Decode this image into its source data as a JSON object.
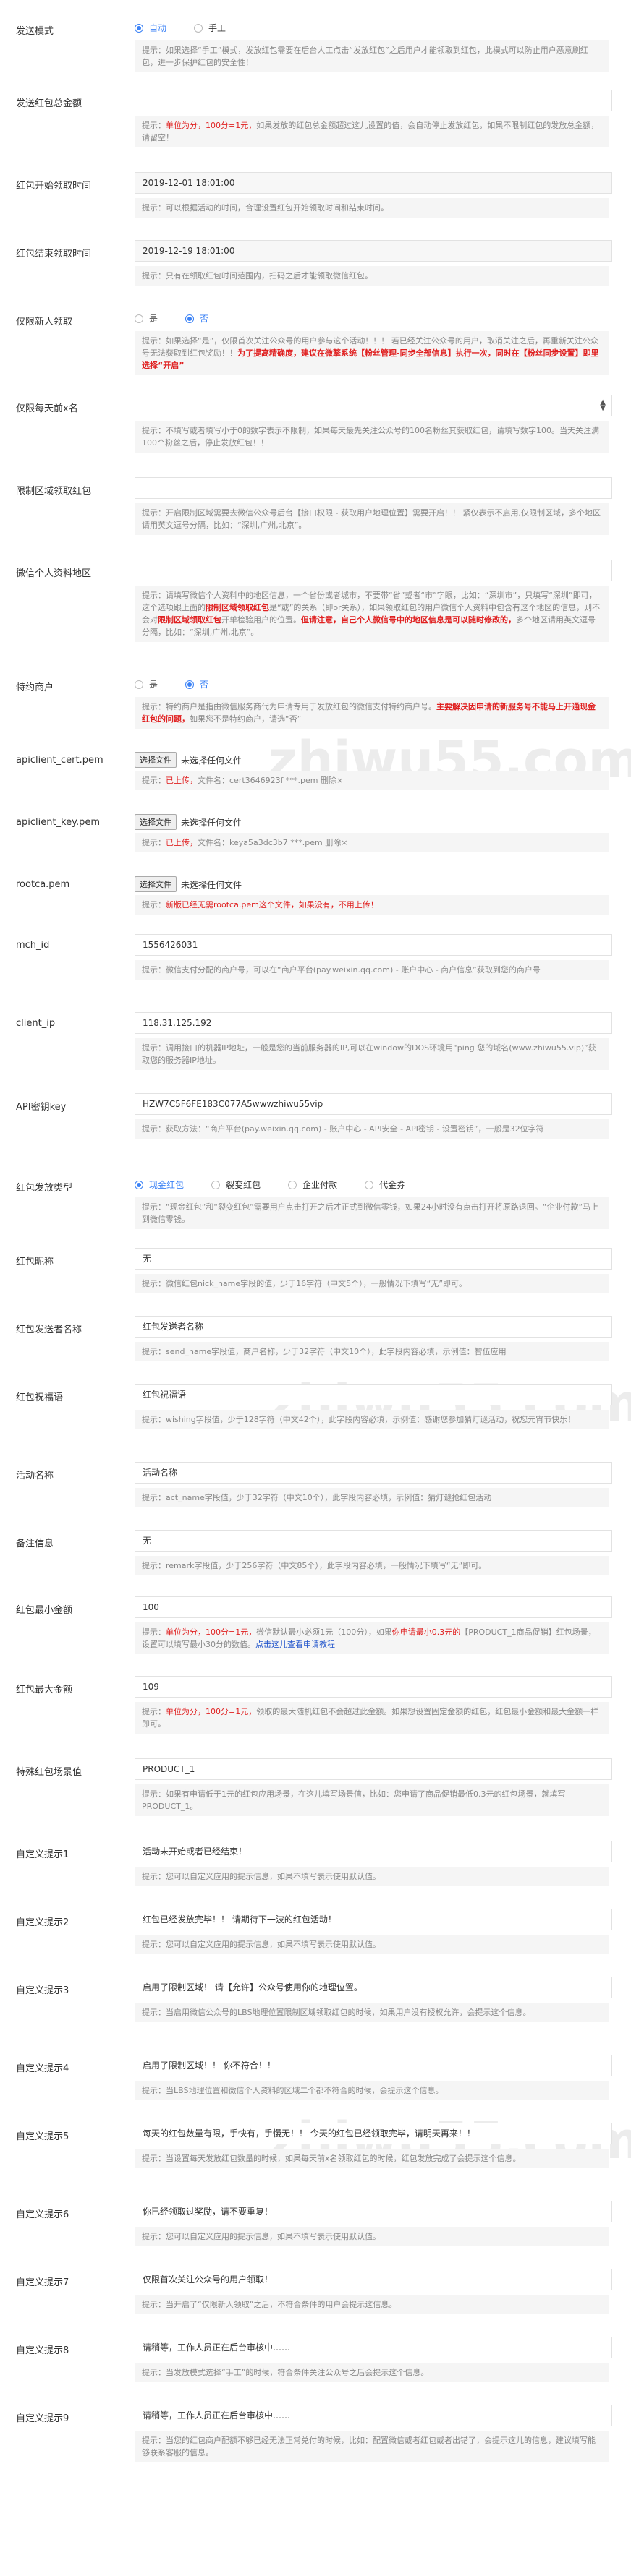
{
  "watermark": "zhiwu55.com",
  "fields": {
    "send_mode": {
      "label": "发送模式",
      "options": [
        {
          "label": "自动",
          "checked": true
        },
        {
          "label": "手工",
          "checked": false
        }
      ],
      "hint": "提示：如果选择“手工”模式，发放红包需要在后台人工点击“发放红包”之后用户才能领取到红包，此模式可以防止用户恶意刷红包，进一步保护红包的安全性！"
    },
    "total_amount": {
      "label": "发送红包总金额",
      "value": "",
      "hint_red": "单位为分，100分=1元，",
      "hint": "如果发放的红包总金额超过这儿设置的值，会自动停止发放红包，如果不限制红包的发放总金额，请留空！"
    },
    "start_time": {
      "label": "红包开始领取时间",
      "label_bold": "开始",
      "value": "2019-12-01 18:01:00",
      "hint": "提示：可以根据活动的时间，合理设置红包开始领取时间和结束时间。"
    },
    "end_time": {
      "label": "红包结束领取时间",
      "label_bold": "结束",
      "value": "2019-12-19 18:01:00",
      "hint": "提示：只有在领取红包时间范围内，扫码之后才能领取微信红包。"
    },
    "new_user": {
      "label": "仅限新人领取",
      "options": [
        {
          "label": "是",
          "checked": false
        },
        {
          "label": "否",
          "checked": true
        }
      ],
      "hint": "提示：如果选择“是”，仅限首次关注公众号的用户参与这个活动！！！ 若已经关注公众号的用户，取消关注之后，再重新关注公众号无法获取到红包奖励！！",
      "hint_red": "为了提高精确度，建议在微擎系统【粉丝管理-同步全部信息】执行一次，同时在【粉丝同步设置】即里选择“开启”"
    },
    "daily_limit": {
      "label": "仅限每天前x名",
      "value": "",
      "hint": "提示：不填写或者填写小于0的数字表示不限制，如果每天最先关注公众号的100名粉丝其获取红包，请填写数字100。当天关注满100个粉丝之后，停止发放红包！！"
    },
    "region_limit": {
      "label": "限制区域领取红包",
      "value": "",
      "hint": "提示：开启限制区域需要去微信公众号后台【接口权限 - 获取用户地理位置】需要开启！！ 紧仅表示不启用,仅限制区域，多个地区请用英文逗号分隔，比如：“深圳,广州,北京”。"
    },
    "personal_region": {
      "label": "微信个人资料地区",
      "value": "",
      "hint": "提示：请填写微信个人资料中的地区信息，一个省份或者城市，不要带“省”或者“市”字眼，比如：“深圳市”，只填写“深圳”即可，这个选项跟上面的",
      "hint_red": "限制区域领取红包",
      "hint2": "是“或”的关系（即or关系），如果领取红包的用户微信个人资料中包含有这个地区的信息，则不会对",
      "hint_red2": "限制区域领取红包",
      "hint3": "开单检验用户的位置。",
      "hint_red3": "但请注意，自己个人微信号中的地区信息是可以随时修改的，",
      "hint4": "多个地区请用英文逗号分隔，比如：“深圳,广州,北京”。"
    },
    "special_merchant": {
      "label": "特约商户",
      "options": [
        {
          "label": "是",
          "checked": false
        },
        {
          "label": "否",
          "checked": true
        }
      ],
      "hint": "提示：特约商户是指由微信服务商代为申请专用于发放红包的微信支付特约商户号。",
      "hint_red": "主要解决因申请的新服务号不能马上开通现金红包的问题，",
      "hint2": "如果您不是特约商户，请选“否”"
    },
    "cert_pem": {
      "label": "apiclient_cert.pem",
      "btn": "选择文件",
      "nofile": "未选择任何文件",
      "hint_red": "已上传，",
      "hint": "文件名：cert3646923f ***.pem 删除×"
    },
    "key_pem": {
      "label": "apiclient_key.pem",
      "btn": "选择文件",
      "nofile": "未选择任何文件",
      "hint_red": "已上传，",
      "hint": "文件名：keya5a3dc3b7 ***.pem 删除×"
    },
    "rootca_pem": {
      "label": "rootca.pem",
      "btn": "选择文件",
      "nofile": "未选择任何文件",
      "hint_red": "新版已经无需rootca.pem这个文件，如果没有，不用上传！"
    },
    "mch_id": {
      "label": "mch_id",
      "value": "1556426031",
      "hint": "提示：微信支付分配的商户号，可以在“商户平台(pay.weixin.qq.com) - 账户中心 - 商户信息”获取到您的商户号"
    },
    "client_ip": {
      "label": "client_ip",
      "value": "118.31.125.192",
      "hint": "提示：调用接口的机器IP地址，一般是您的当前服务器的IP,可以在window的DOS环境用“ping 您的域名(www.zhiwu55.vip)”获取您的服务器IP地址。"
    },
    "api_key": {
      "label": "API密钥key",
      "value": "HZW7C5F6FE183C077A5wwwzhiwu55vip",
      "hint": "提示：获取方法：“商户平台(pay.weixin.qq.com) - 账户中心 - API安全 - API密钥 - 设置密钥”，一般是32位字符"
    },
    "packet_type": {
      "label": "红包发放类型",
      "options": [
        {
          "label": "现金红包",
          "checked": true
        },
        {
          "label": "裂变红包",
          "checked": false
        },
        {
          "label": "企业付款",
          "checked": false
        },
        {
          "label": "代金券",
          "checked": false
        }
      ],
      "hint": "提示：“现金红包”和“裂变红包”需要用户点击打开之后才正式到微信零钱，如果24小时没有点击打开将原路退回。“企业付款”马上到微信零钱。"
    },
    "nick_name": {
      "label": "红包昵称",
      "value": "无",
      "hint": "提示：微信红包nick_name字段的值，少于16字符（中文5个），一般情况下填写“无”即可。"
    },
    "send_name": {
      "label": "红包发送者名称",
      "value": "红包发送者名称",
      "hint": "提示：send_name字段值，商户名称，少于32字符（中文10个），此字段内容必填，示例值：智伍应用"
    },
    "wishing": {
      "label": "红包祝福语",
      "value": "红包祝福语",
      "hint": "提示：wishing字段值，少于128字符（中文42个），此字段内容必填，示例值：感谢您参加猜灯谜活动，祝您元宵节快乐！"
    },
    "act_name": {
      "label": "活动名称",
      "value": "活动名称",
      "hint": "提示：act_name字段值，少于32字符（中文10个），此字段内容必填，示例值：猜灯谜抢红包活动"
    },
    "remark": {
      "label": "备注信息",
      "value": "无",
      "hint": "提示：remark字段值，少于256字符（中文85个），此字段内容必填，一般情况下填写“无”即可。"
    },
    "min_amount": {
      "label": "红包最小金额",
      "value": "100",
      "hint_red": "单位为分，100分=1元，",
      "hint": "微信默认最小必须1元（100分），如果",
      "hint_red2": "你申请最小0.3元的",
      "hint2": "【PRODUCT_1商品促销】红包场景，设置可以填写最小30分的数值。",
      "hint_link": "点击这儿查看申请教程"
    },
    "max_amount": {
      "label": "红包最大金额",
      "value": "109",
      "hint_red": "单位为分，100分=1元，",
      "hint": "领取的最大随机红包不会超过此金额。如果想设置固定金额的红包，红包最小金额和最大金额一样即可。"
    },
    "scene_id": {
      "label": "特殊红包场景值",
      "value": "PRODUCT_1",
      "hint": "提示：如果有申请低于1元的红包应用场景，在这儿填写场景值，比如：您申请了商品促销最低0.3元的红包场景，就填写PRODUCT_1。"
    },
    "custom1": {
      "label": "自定义提示1",
      "value": "活动未开始或者已经结束！",
      "hint": "提示：您可以自定义应用的提示信息，如果不填写表示使用默认值。"
    },
    "custom2": {
      "label": "自定义提示2",
      "value": "红包已经发放完毕！！ 请期待下一波的红包活动！",
      "hint": "提示：您可以自定义应用的提示信息，如果不填写表示使用默认值。"
    },
    "custom3": {
      "label": "自定义提示3",
      "value": "启用了限制区域！ 请【允许】公众号使用你的地理位置。",
      "hint": "提示：当启用微信公众号的LBS地理位置限制区域领取红包的时候，如果用户没有授权允许，会提示这个信息。"
    },
    "custom4": {
      "label": "自定义提示4",
      "value": "启用了限制区域！！ 你不符合！！",
      "hint": "提示：当LBS地理位置和微信个人资料的区域二个都不符合的时候，会提示这个信息。"
    },
    "custom5": {
      "label": "自定义提示5",
      "value": "每天的红包数量有限，手快有，手慢无！！ 今天的红包已经领取完毕，请明天再来！！",
      "hint": "提示：当设置每天发放红包数量的时候，如果每天前x名领取红包的时候，红包发放完成了会提示这个信息。"
    },
    "custom6": {
      "label": "自定义提示6",
      "value": "你已经领取过奖励，请不要重复！",
      "hint": "提示：您可以自定义应用的提示信息，如果不填写表示使用默认值。"
    },
    "custom7": {
      "label": "自定义提示7",
      "value": "仅限首次关注公众号的用户领取！",
      "hint": "提示：当开启了“仅限新人领取”之后，不符合条件的用户会提示这信息。"
    },
    "custom8": {
      "label": "自定义提示8",
      "value": "请稍等，工作人员正在后台审核中……",
      "hint": "提示：当发放模式选择“手工”的时候，符合条件关注公众号之后会提示这个信息。"
    },
    "custom9": {
      "label": "自定义提示9",
      "value": "请稍等，工作人员正在后台审核中……",
      "hint": "提示：当您的红包商户配额不够已经无法正常兑付的时候，比如：配置微信或者红包或者出错了，会提示这儿的信息，建议填写能够联系客服的信息。"
    }
  },
  "colors": {
    "accent": "#3b82f6",
    "warning": "#e02020",
    "link": "#2255cc",
    "hint_bg": "#f5f5f5"
  }
}
